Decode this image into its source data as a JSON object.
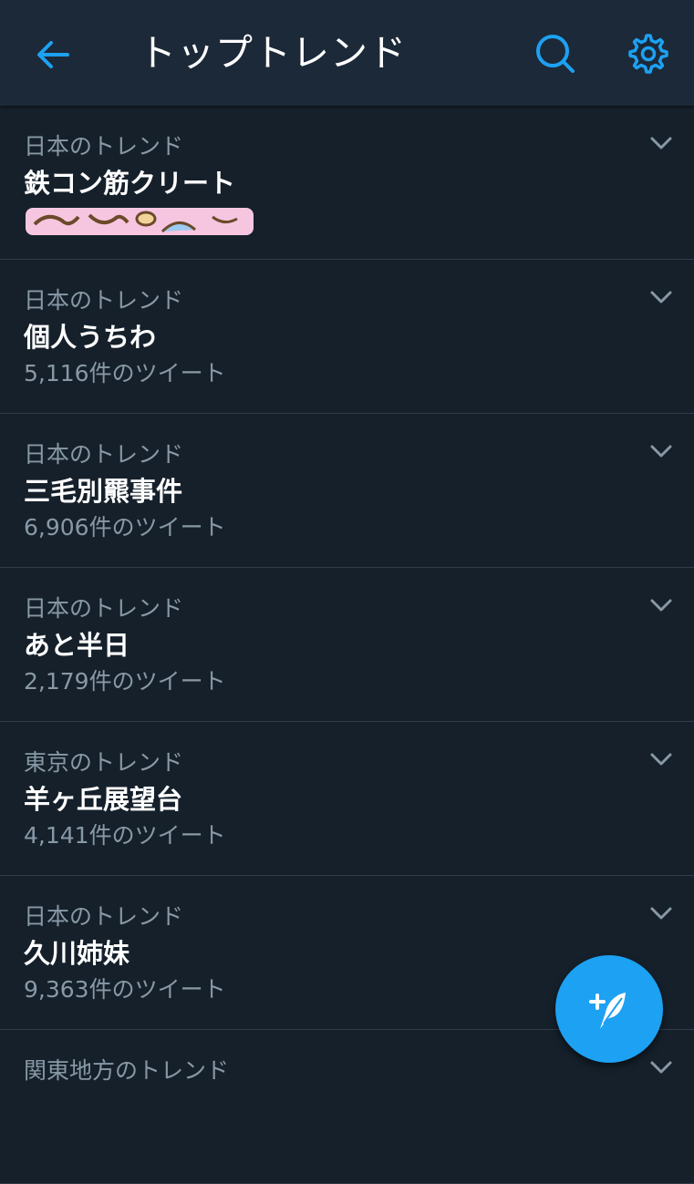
{
  "header": {
    "title": "トップトレンド",
    "back_icon": "arrow-left-icon",
    "search_icon": "search-icon",
    "settings_icon": "gear-icon"
  },
  "trends": [
    {
      "context": "日本のトレンド",
      "name": "鉄コン筋クリート",
      "count": ""
    },
    {
      "context": "日本のトレンド",
      "name": "個人うちわ",
      "count": "5,116件のツイート"
    },
    {
      "context": "日本のトレンド",
      "name": "三毛別羆事件",
      "count": "6,906件のツイート"
    },
    {
      "context": "日本のトレンド",
      "name": "あと半日",
      "count": "2,179件のツイート"
    },
    {
      "context": "東京のトレンド",
      "name": "羊ヶ丘展望台",
      "count": "4,141件のツイート"
    },
    {
      "context": "日本のトレンド",
      "name": "久川姉妹",
      "count": "9,363件のツイート"
    },
    {
      "context": "関東地方のトレンド",
      "name": "",
      "count": ""
    }
  ],
  "fab": {
    "icon": "compose-tweet-icon"
  },
  "colors": {
    "background": "#15202b",
    "header": "#1c2938",
    "accent": "#1da1f2",
    "secondary_text": "#8899a6",
    "divider": "#2f3d4b"
  }
}
